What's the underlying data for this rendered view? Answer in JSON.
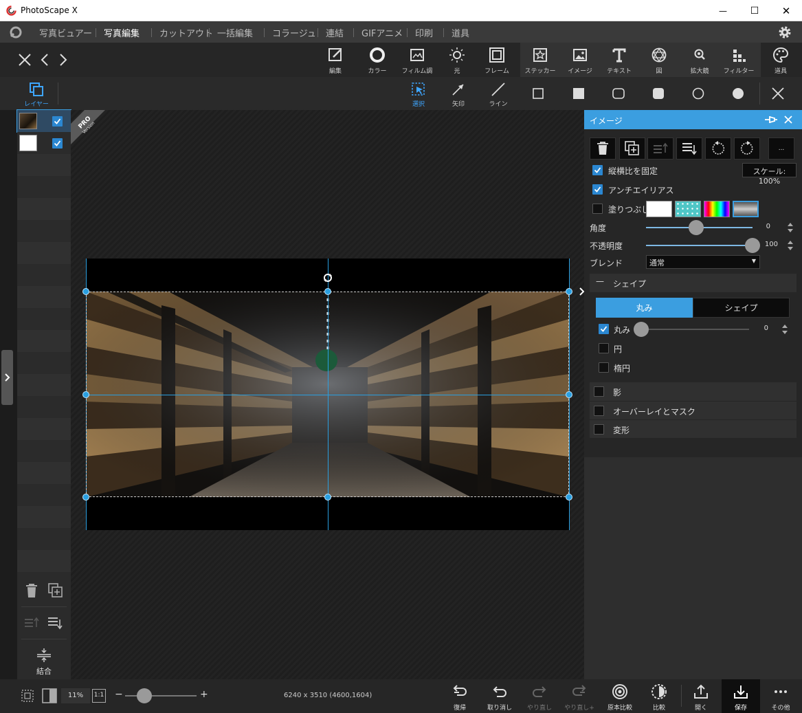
{
  "window": {
    "title": "PhotoScape X",
    "minimize_glyph": "—",
    "maximize_glyph": "☐",
    "close_glyph": "✕"
  },
  "menu": {
    "items": [
      "写真ビュアー",
      "写真編集",
      "カットアウト",
      "一括編集",
      "コラージュ",
      "連結",
      "GIFアニメ",
      "印刷",
      "道具"
    ],
    "active": "写真編集"
  },
  "toolbar": {
    "tools": [
      {
        "label": "編集",
        "icon": "edit-icon"
      },
      {
        "label": "カラー",
        "icon": "color-icon"
      },
      {
        "label": "フィルム調",
        "icon": "film-icon"
      },
      {
        "label": "光",
        "icon": "light-icon"
      },
      {
        "label": "フレーム",
        "icon": "frame-icon"
      },
      {
        "label": "ステッカー",
        "icon": "sticker-icon"
      },
      {
        "label": "イメージ",
        "icon": "image-icon"
      },
      {
        "label": "テキスト",
        "icon": "text-icon"
      },
      {
        "label": "図",
        "icon": "figure-icon"
      },
      {
        "label": "拡大鏡",
        "icon": "magnifier-icon"
      },
      {
        "label": "フィルター",
        "icon": "filter-icon"
      },
      {
        "label": "道具",
        "icon": "palette-icon"
      }
    ]
  },
  "subtoolbar": {
    "layer_label": "レイヤー",
    "select_label": "選択",
    "arrow_label": "矢印",
    "line_label": "ライン"
  },
  "layers": {
    "merge_label": "結合"
  },
  "pro_badge": {
    "line1": "PRO",
    "line2": "Version"
  },
  "panel": {
    "title": "イメージ",
    "more_label": "...",
    "keep_ratio": {
      "label": "縦横比を固定",
      "checked": true
    },
    "scale_label": "スケール: 100%",
    "antialias": {
      "label": "アンチエイリアス",
      "checked": true
    },
    "fill": {
      "label": "塗りつぶし",
      "checked": false
    },
    "angle": {
      "label": "角度",
      "value": "0",
      "fraction": 0.47
    },
    "opacity": {
      "label": "不透明度",
      "value": "100",
      "fraction": 1.0
    },
    "blend": {
      "label": "ブレンド",
      "value": "通常"
    },
    "shape_section": {
      "collapse_glyph": "—",
      "label": "シェイプ"
    },
    "segments": {
      "round": "丸み",
      "shape": "シェイプ",
      "active": "round"
    },
    "round": {
      "label": "丸み",
      "checked": true,
      "value": "0",
      "fraction": 0.0
    },
    "circle": {
      "label": "円",
      "checked": false
    },
    "ellipse": {
      "label": "楕円",
      "checked": false
    },
    "shadow": {
      "label": "影"
    },
    "overlay": {
      "label": "オーバーレイとマスク"
    },
    "transform": {
      "label": "変形"
    }
  },
  "status": {
    "zoom": "11%",
    "one_to_one": "1:1",
    "zoom_fraction": 0.27,
    "dimensions": "6240 x 3510 (4600,1604)",
    "buttons": [
      {
        "label": "復帰",
        "icon": "revert-icon",
        "enabled": true
      },
      {
        "label": "取り消し",
        "icon": "undo-icon",
        "enabled": true
      },
      {
        "label": "やり直し",
        "icon": "redo-icon",
        "enabled": false
      },
      {
        "label": "やり直し+",
        "icon": "redo-plus-icon",
        "enabled": false
      },
      {
        "label": "原本比較",
        "icon": "compare-original-icon",
        "enabled": true
      },
      {
        "label": "比較",
        "icon": "compare-icon",
        "enabled": true
      },
      {
        "label": "開く",
        "icon": "open-icon",
        "enabled": true
      },
      {
        "label": "保存",
        "icon": "save-icon",
        "enabled": true
      },
      {
        "label": "その他",
        "icon": "more-icon",
        "enabled": true
      }
    ]
  },
  "colors": {
    "accent": "#3b9ee0",
    "handle": "#2a9fe0",
    "panel_bg": "#262626"
  }
}
